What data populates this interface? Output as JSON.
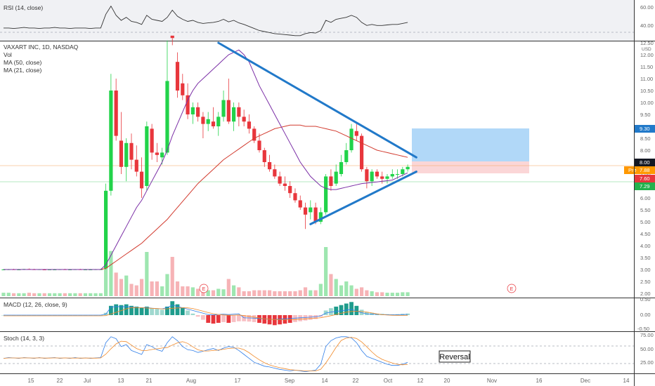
{
  "chart_data": {
    "type": "candlestick",
    "symbol_line": "VAXART INC, 1D, NASDAQ",
    "price_panel": {
      "indicators": [
        "Vol",
        "MA (50, close)",
        "MA (21, close)"
      ],
      "y_ticks": [
        "12.50",
        "12.00",
        "11.50",
        "11.00",
        "10.50",
        "10.00",
        "9.50",
        "9.00",
        "8.50",
        "8.00",
        "7.50",
        "7.00",
        "6.50",
        "6.00",
        "5.50",
        "5.00",
        "4.50",
        "4.00",
        "3.50",
        "3.00",
        "2.50",
        "2.00"
      ],
      "currency": "USD",
      "ylim": [
        1.95,
        12.7
      ],
      "tags": {
        "target": "9.30",
        "entry": "8.00",
        "pre_label": "Pre",
        "pre": "7.88",
        "last": "7.60",
        "stop": "7.29"
      },
      "candles": [
        [
          3.0,
          3.02,
          2.98,
          3.0
        ],
        [
          3.0,
          3.02,
          2.98,
          3.01
        ],
        [
          3.01,
          3.03,
          2.99,
          3.0
        ],
        [
          3.0,
          3.02,
          2.98,
          3.0
        ],
        [
          3.0,
          3.03,
          2.98,
          3.02
        ],
        [
          3.02,
          3.04,
          3.0,
          3.01
        ],
        [
          3.01,
          3.03,
          2.99,
          3.0
        ],
        [
          3.0,
          3.02,
          2.98,
          3.01
        ],
        [
          3.0,
          3.02,
          2.98,
          2.99
        ],
        [
          2.99,
          3.01,
          2.97,
          3.0
        ],
        [
          3.0,
          3.02,
          2.98,
          3.0
        ],
        [
          3.0,
          3.02,
          2.98,
          3.01
        ],
        [
          3.01,
          3.03,
          2.99,
          3.0
        ],
        [
          3.0,
          3.02,
          2.98,
          3.0
        ],
        [
          3.0,
          3.02,
          2.98,
          3.01
        ],
        [
          3.01,
          3.03,
          2.99,
          3.0
        ],
        [
          3.0,
          3.02,
          2.98,
          3.0
        ],
        [
          3.0,
          3.02,
          2.98,
          3.0
        ],
        [
          3.0,
          3.02,
          2.98,
          3.01
        ],
        [
          3.01,
          3.03,
          2.99,
          3.01
        ],
        [
          3.05,
          6.6,
          3.0,
          6.3
        ],
        [
          6.3,
          11.2,
          6.1,
          10.5
        ],
        [
          10.5,
          11.0,
          8.4,
          8.6
        ],
        [
          8.4,
          9.6,
          7.0,
          7.3
        ],
        [
          7.3,
          8.5,
          6.7,
          8.3
        ],
        [
          8.3,
          8.7,
          7.2,
          7.6
        ],
        [
          7.6,
          8.2,
          6.9,
          7.1
        ],
        [
          7.1,
          7.7,
          6.0,
          6.4
        ],
        [
          6.5,
          9.2,
          6.3,
          9.0
        ],
        [
          8.9,
          9.1,
          7.6,
          7.9
        ],
        [
          7.9,
          8.3,
          7.5,
          7.8
        ],
        [
          7.7,
          8.1,
          7.4,
          7.9
        ],
        [
          7.9,
          12.6,
          7.8,
          10.9
        ],
        [
          14.0,
          14.2,
          12.4,
          12.7
        ],
        [
          11.7,
          12.1,
          10.2,
          10.5
        ],
        [
          10.8,
          11.2,
          10.1,
          10.3
        ],
        [
          10.3,
          10.8,
          9.3,
          9.5
        ],
        [
          9.5,
          10.0,
          9.1,
          9.8
        ],
        [
          9.8,
          10.0,
          9.2,
          9.4
        ],
        [
          9.4,
          9.6,
          8.5,
          9.1
        ],
        [
          9.1,
          9.6,
          8.8,
          9.3
        ],
        [
          9.2,
          9.8,
          8.9,
          9.0
        ],
        [
          9.0,
          9.6,
          8.6,
          9.4
        ],
        [
          9.4,
          10.5,
          9.2,
          10.1
        ],
        [
          10.1,
          11.0,
          9.1,
          9.2
        ],
        [
          9.2,
          10.0,
          8.8,
          9.8
        ],
        [
          9.8,
          10.0,
          9.0,
          9.4
        ],
        [
          9.4,
          9.7,
          9.0,
          9.2
        ],
        [
          9.2,
          9.5,
          8.7,
          8.9
        ],
        [
          8.9,
          9.0,
          8.3,
          8.4
        ],
        [
          8.4,
          8.7,
          7.9,
          8.0
        ],
        [
          8.0,
          8.1,
          7.3,
          7.5
        ],
        [
          7.5,
          7.8,
          7.1,
          7.2
        ],
        [
          7.2,
          7.4,
          6.8,
          6.9
        ],
        [
          6.9,
          7.1,
          6.5,
          6.6
        ],
        [
          6.6,
          6.9,
          6.3,
          6.5
        ],
        [
          6.5,
          6.7,
          6.0,
          6.2
        ],
        [
          6.2,
          6.4,
          5.8,
          5.9
        ],
        [
          5.9,
          6.1,
          5.5,
          5.6
        ],
        [
          5.6,
          5.8,
          4.7,
          5.3
        ],
        [
          5.4,
          5.9,
          5.1,
          5.6
        ],
        [
          5.6,
          5.8,
          4.9,
          5.0
        ],
        [
          5.0,
          5.6,
          4.9,
          5.4
        ],
        [
          5.4,
          7.0,
          5.3,
          6.9
        ],
        [
          6.9,
          7.2,
          6.3,
          6.5
        ],
        [
          6.6,
          7.4,
          6.5,
          7.1
        ],
        [
          7.0,
          7.8,
          6.9,
          7.5
        ],
        [
          7.5,
          8.3,
          7.4,
          8.0
        ],
        [
          8.0,
          9.1,
          7.9,
          8.9
        ],
        [
          8.8,
          9.1,
          8.4,
          8.6
        ],
        [
          8.6,
          8.7,
          7.1,
          7.2
        ],
        [
          7.2,
          7.3,
          6.4,
          6.7
        ],
        [
          6.7,
          7.2,
          6.5,
          7.1
        ],
        [
          7.1,
          7.2,
          6.8,
          6.9
        ],
        [
          6.9,
          7.1,
          6.6,
          6.8
        ],
        [
          6.8,
          7.0,
          6.6,
          6.9
        ],
        [
          6.9,
          7.2,
          6.8,
          7.0
        ],
        [
          7.0,
          7.2,
          6.8,
          7.0
        ],
        [
          7.0,
          7.3,
          6.9,
          7.2
        ],
        [
          7.2,
          7.4,
          7.1,
          7.3
        ]
      ],
      "volume": [
        0.07,
        0.07,
        0.06,
        0.06,
        0.06,
        0.07,
        0.06,
        0.06,
        0.06,
        0.06,
        0.06,
        0.06,
        0.06,
        0.06,
        0.06,
        0.06,
        0.06,
        0.06,
        0.06,
        0.06,
        0.85,
        0.92,
        0.48,
        0.35,
        0.42,
        0.25,
        0.22,
        0.35,
        0.9,
        0.3,
        0.3,
        0.2,
        0.45,
        0.8,
        0.3,
        0.2,
        0.2,
        0.18,
        0.15,
        0.15,
        0.12,
        0.12,
        0.15,
        0.14,
        0.35,
        0.22,
        0.18,
        0.1,
        0.1,
        0.12,
        0.12,
        0.12,
        0.12,
        0.1,
        0.1,
        0.1,
        0.1,
        0.1,
        0.12,
        0.18,
        0.12,
        0.12,
        0.25,
        1.0,
        0.45,
        0.35,
        0.22,
        0.3,
        0.22,
        0.15,
        0.18,
        0.12,
        0.1,
        0.08,
        0.08,
        0.07,
        0.07,
        0.07,
        0.08,
        0.08
      ],
      "ma21": [
        3.0,
        3.0,
        3.0,
        3.0,
        3.0,
        3.0,
        3.0,
        3.0,
        3.0,
        3.0,
        3.0,
        3.0,
        3.0,
        3.0,
        3.0,
        3.0,
        3.0,
        3.0,
        3.0,
        3.0,
        3.2,
        3.6,
        4.0,
        4.4,
        4.8,
        5.2,
        5.6,
        5.9,
        6.3,
        6.7,
        7.1,
        7.5,
        8.0,
        8.6,
        9.1,
        9.6,
        10.1,
        10.5,
        10.8,
        11.0,
        11.2,
        11.4,
        11.6,
        11.8,
        12.0,
        12.1,
        12.2,
        12.0,
        11.7,
        11.2,
        10.7,
        10.3,
        9.9,
        9.5,
        9.1,
        8.7,
        8.3,
        7.9,
        7.5,
        7.2,
        6.9,
        6.7,
        6.5,
        6.4,
        6.35,
        6.35,
        6.4,
        6.45,
        6.5,
        6.55,
        6.6,
        6.62,
        6.65,
        6.67,
        6.7,
        6.72,
        6.75,
        6.85,
        6.95,
        7.05
      ],
      "ma50": [
        3.0,
        3.0,
        3.0,
        3.0,
        3.0,
        3.0,
        3.0,
        3.0,
        3.0,
        3.0,
        3.0,
        3.0,
        3.0,
        3.0,
        3.0,
        3.0,
        3.0,
        3.0,
        3.0,
        3.0,
        3.05,
        3.2,
        3.35,
        3.5,
        3.65,
        3.8,
        3.95,
        4.1,
        4.3,
        4.5,
        4.7,
        4.9,
        5.1,
        5.35,
        5.6,
        5.85,
        6.1,
        6.35,
        6.6,
        6.8,
        7.0,
        7.2,
        7.4,
        7.6,
        7.75,
        7.9,
        8.05,
        8.2,
        8.35,
        8.5,
        8.6,
        8.7,
        8.8,
        8.9,
        8.95,
        9.0,
        9.05,
        9.05,
        9.05,
        9.0,
        9.0,
        9.0,
        8.95,
        8.9,
        8.85,
        8.8,
        8.7,
        8.6,
        8.5,
        8.4,
        8.3,
        8.2,
        8.1,
        8.0,
        7.95,
        7.9,
        7.85,
        7.8,
        7.75,
        7.7
      ],
      "trendlines": [
        {
          "from": [
            42,
            12.5
          ],
          "to": [
            80,
            7.7
          ]
        },
        {
          "from": [
            60,
            4.9
          ],
          "to": [
            80,
            7.1
          ]
        }
      ],
      "earnings_markers": [
        "E",
        "E"
      ]
    },
    "rsi_panel": {
      "label": "RSI (14, close)",
      "y_ticks": [
        "60.00",
        "40.00"
      ]
    },
    "macd_panel": {
      "label": "MACD (12, 26, close, 9)",
      "y_ticks": [
        "0.50",
        "0.00",
        "-0.50"
      ]
    },
    "stoch_panel": {
      "label": "Stoch (14, 3, 3)",
      "y_ticks": [
        "75.00",
        "50.00",
        "25.00"
      ],
      "annotation": "Reversal"
    },
    "x_ticks": [
      "15",
      "22",
      "Jul",
      "13",
      "21",
      "Aug",
      "17",
      "Sep",
      "14",
      "22",
      "Oct",
      "12",
      "20",
      "Nov",
      "16",
      "Dec",
      "14"
    ],
    "colors": {
      "up": "#22d34a",
      "down": "#e8363c",
      "ma21": "#d23a2e",
      "ma50": "#7b2fa6",
      "trend": "#2179c9",
      "target_zone": "#a8d4f7",
      "stop_zone": "#fbd1d3",
      "macd_pos": "#1e9c8c",
      "macd_neg": "#e8363c"
    }
  }
}
